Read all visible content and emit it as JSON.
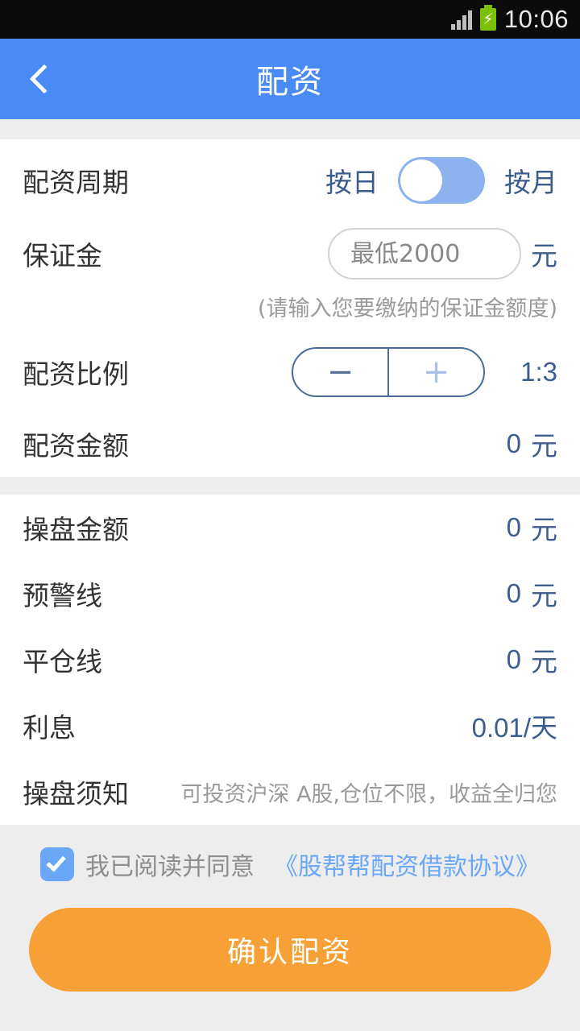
{
  "status_bar": {
    "time": "10:06",
    "signal_icon": "signal-bars-icon",
    "battery_icon": "battery-charging-icon",
    "battery_glyph": "⚡"
  },
  "app_bar": {
    "back_icon": "chevron-left-icon",
    "title": "配资"
  },
  "form": {
    "cycle": {
      "label": "配资周期",
      "option_left": "按日",
      "option_right": "按月",
      "selected": "按日"
    },
    "deposit": {
      "label": "保证金",
      "value": "",
      "placeholder": "最低2000",
      "unit": "元",
      "hint": "(请输入您要缴纳的保证金额度)"
    },
    "ratio": {
      "label": "配资比例",
      "minus_label": "−",
      "plus_label": "+",
      "value": "1:3"
    },
    "allocation_amount": {
      "label": "配资金额",
      "value": "0",
      "unit": "元"
    }
  },
  "summary": {
    "rows": [
      {
        "label": "操盘金额",
        "value": "0",
        "unit": "元"
      },
      {
        "label": "预警线",
        "value": "0",
        "unit": "元"
      },
      {
        "label": "平仓线",
        "value": "0",
        "unit": "元"
      }
    ],
    "interest": {
      "label": "利息",
      "value": "0.01/天"
    },
    "notice": {
      "label": "操盘须知",
      "text": "可投资沪深 A股,仓位不限，收益全归您"
    }
  },
  "footer": {
    "checkbox_icon": "checkbox-checked-icon",
    "checked": true,
    "agree_text": "我已阅读并同意",
    "agreement_link": "《股帮帮配资借款协议》",
    "confirm_label": "确认配资"
  },
  "colors": {
    "app_bar": "#4a8af4",
    "accent_blue": "#3c5d8f",
    "toggle_track": "#8cb3f0",
    "link_blue": "#6aa7f7",
    "confirm_orange": "#f7a035",
    "page_gray": "#ededed",
    "battery_green": "#7cc00a"
  }
}
